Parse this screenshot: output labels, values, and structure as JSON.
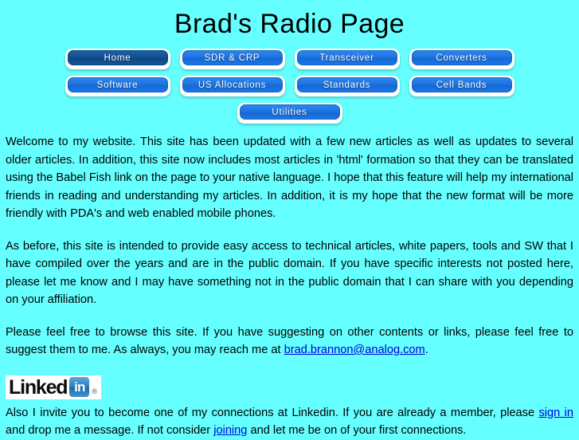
{
  "page": {
    "title": "Brad's Radio Page",
    "background_color": "#66ffff",
    "text_color": "#000000",
    "link_color": "#0000dd"
  },
  "nav": {
    "rows": [
      [
        {
          "label": "Home",
          "active": true
        },
        {
          "label": "SDR & CRP",
          "active": false
        },
        {
          "label": "Transceiver",
          "active": false
        },
        {
          "label": "Converters",
          "active": false
        }
      ],
      [
        {
          "label": "Software",
          "active": false
        },
        {
          "label": "US Allocations",
          "active": false
        },
        {
          "label": "Standards",
          "active": false
        },
        {
          "label": "Cell Bands",
          "active": false
        }
      ],
      [
        {
          "label": "Utilities",
          "active": false
        }
      ]
    ]
  },
  "content": {
    "paragraph1": "Welcome to my website.  This site has been updated with a few new articles as well as updates to several older articles.  In addition, this site now includes most articles in 'html' formation so that they can be translated using the Babel Fish link on the page to your native language.  I hope that this feature will help my international friends in reading and understanding my articles.  In addition, it is my hope that the new format will be more friendly with PDA's and web enabled mobile phones.",
    "paragraph2": "As before, this site is intended to provide easy access to technical articles, white papers, tools and SW that I have compiled over the years and are in the public domain.  If you have specific interests not posted here, please let me know and I may have something not in the public domain that I can share with you depending on your affiliation.",
    "paragraph3_before_email": "Please feel free to browse this site.  If you have suggesting on other contents or links, please feel free to suggest them to me.  As always, you may reach me at ",
    "email_link": "brad.brannon@analog.com",
    "paragraph3_after_email": ".",
    "paragraph4_part1": "Also I invite you to become one of my connections at Linkedin.  If you are already a member, please ",
    "signin_link": "sign in",
    "paragraph4_part2": " and drop me a message.  If not consider ",
    "joining_link": "joining",
    "paragraph4_part3": " and let me be on of your first connections."
  },
  "linkedin_logo": {
    "word": "Linked",
    "badge": "in",
    "registered_mark": "®"
  }
}
